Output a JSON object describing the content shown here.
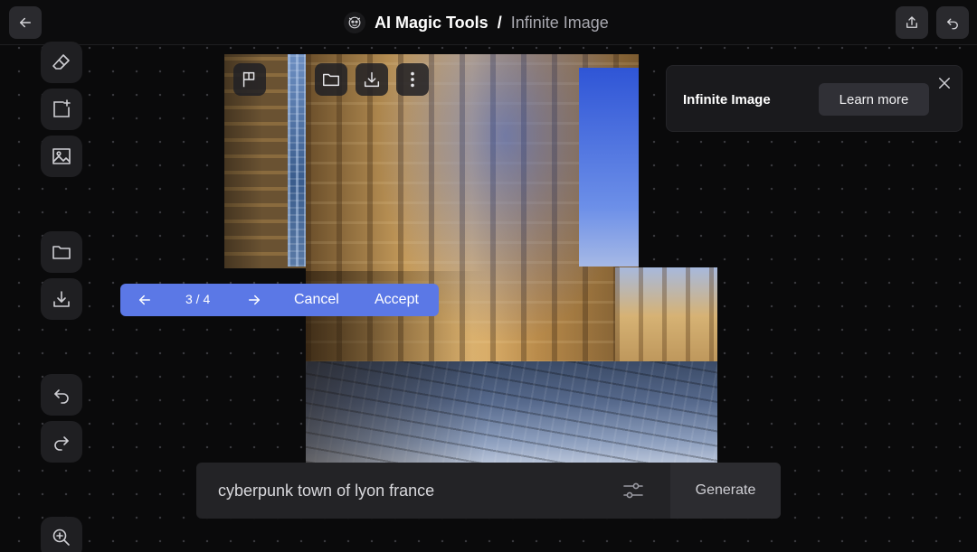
{
  "header": {
    "app_name": "AI Magic Tools",
    "separator": "/",
    "page_name": "Infinite Image"
  },
  "variations": {
    "count": "3 / 4",
    "cancel_label": "Cancel",
    "accept_label": "Accept"
  },
  "info_panel": {
    "title": "Infinite Image",
    "learn_more_label": "Learn more"
  },
  "prompt": {
    "value": "cyberpunk town of lyon france",
    "generate_label": "Generate"
  },
  "left_tools": [
    "eraser-icon",
    "add-frame-icon",
    "image-icon",
    "folder-icon",
    "download-icon",
    "undo-icon",
    "redo-icon",
    "zoom-in-icon"
  ],
  "image_toolbar": [
    "frame-icon",
    "folder-icon",
    "download-icon",
    "more-icon"
  ],
  "colors": {
    "background": "#0a0a0b",
    "accent": "#5b78e6",
    "panel": "#1a1a1d",
    "prompt_bg": "#232326"
  }
}
